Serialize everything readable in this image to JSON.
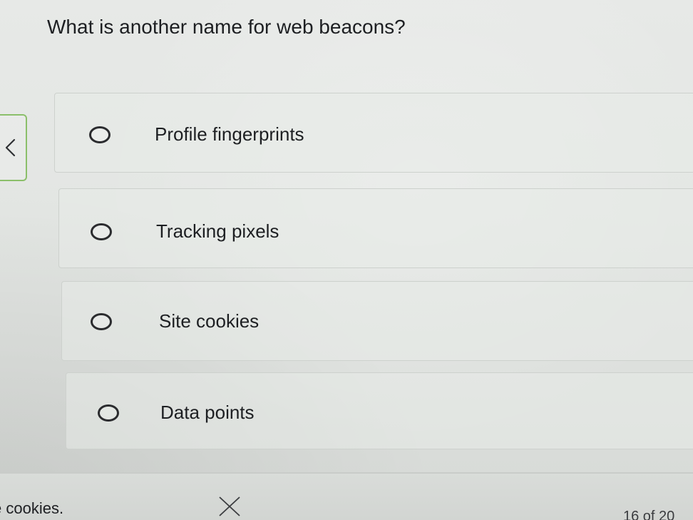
{
  "question": {
    "text": "What is another name for web beacons?"
  },
  "options": [
    {
      "label": "Profile fingerprints",
      "selected": false
    },
    {
      "label": "Tracking pixels",
      "selected": false
    },
    {
      "label": "Site cookies",
      "selected": false
    },
    {
      "label": "Data points",
      "selected": false
    }
  ],
  "footer": {
    "partial_text": "e cookies.",
    "counter": "16 of 20"
  },
  "icons": {
    "back": "chevron-left-icon",
    "close": "close-icon"
  },
  "colors": {
    "accent_border": "#8bbf6a",
    "text": "#1d1f22"
  }
}
